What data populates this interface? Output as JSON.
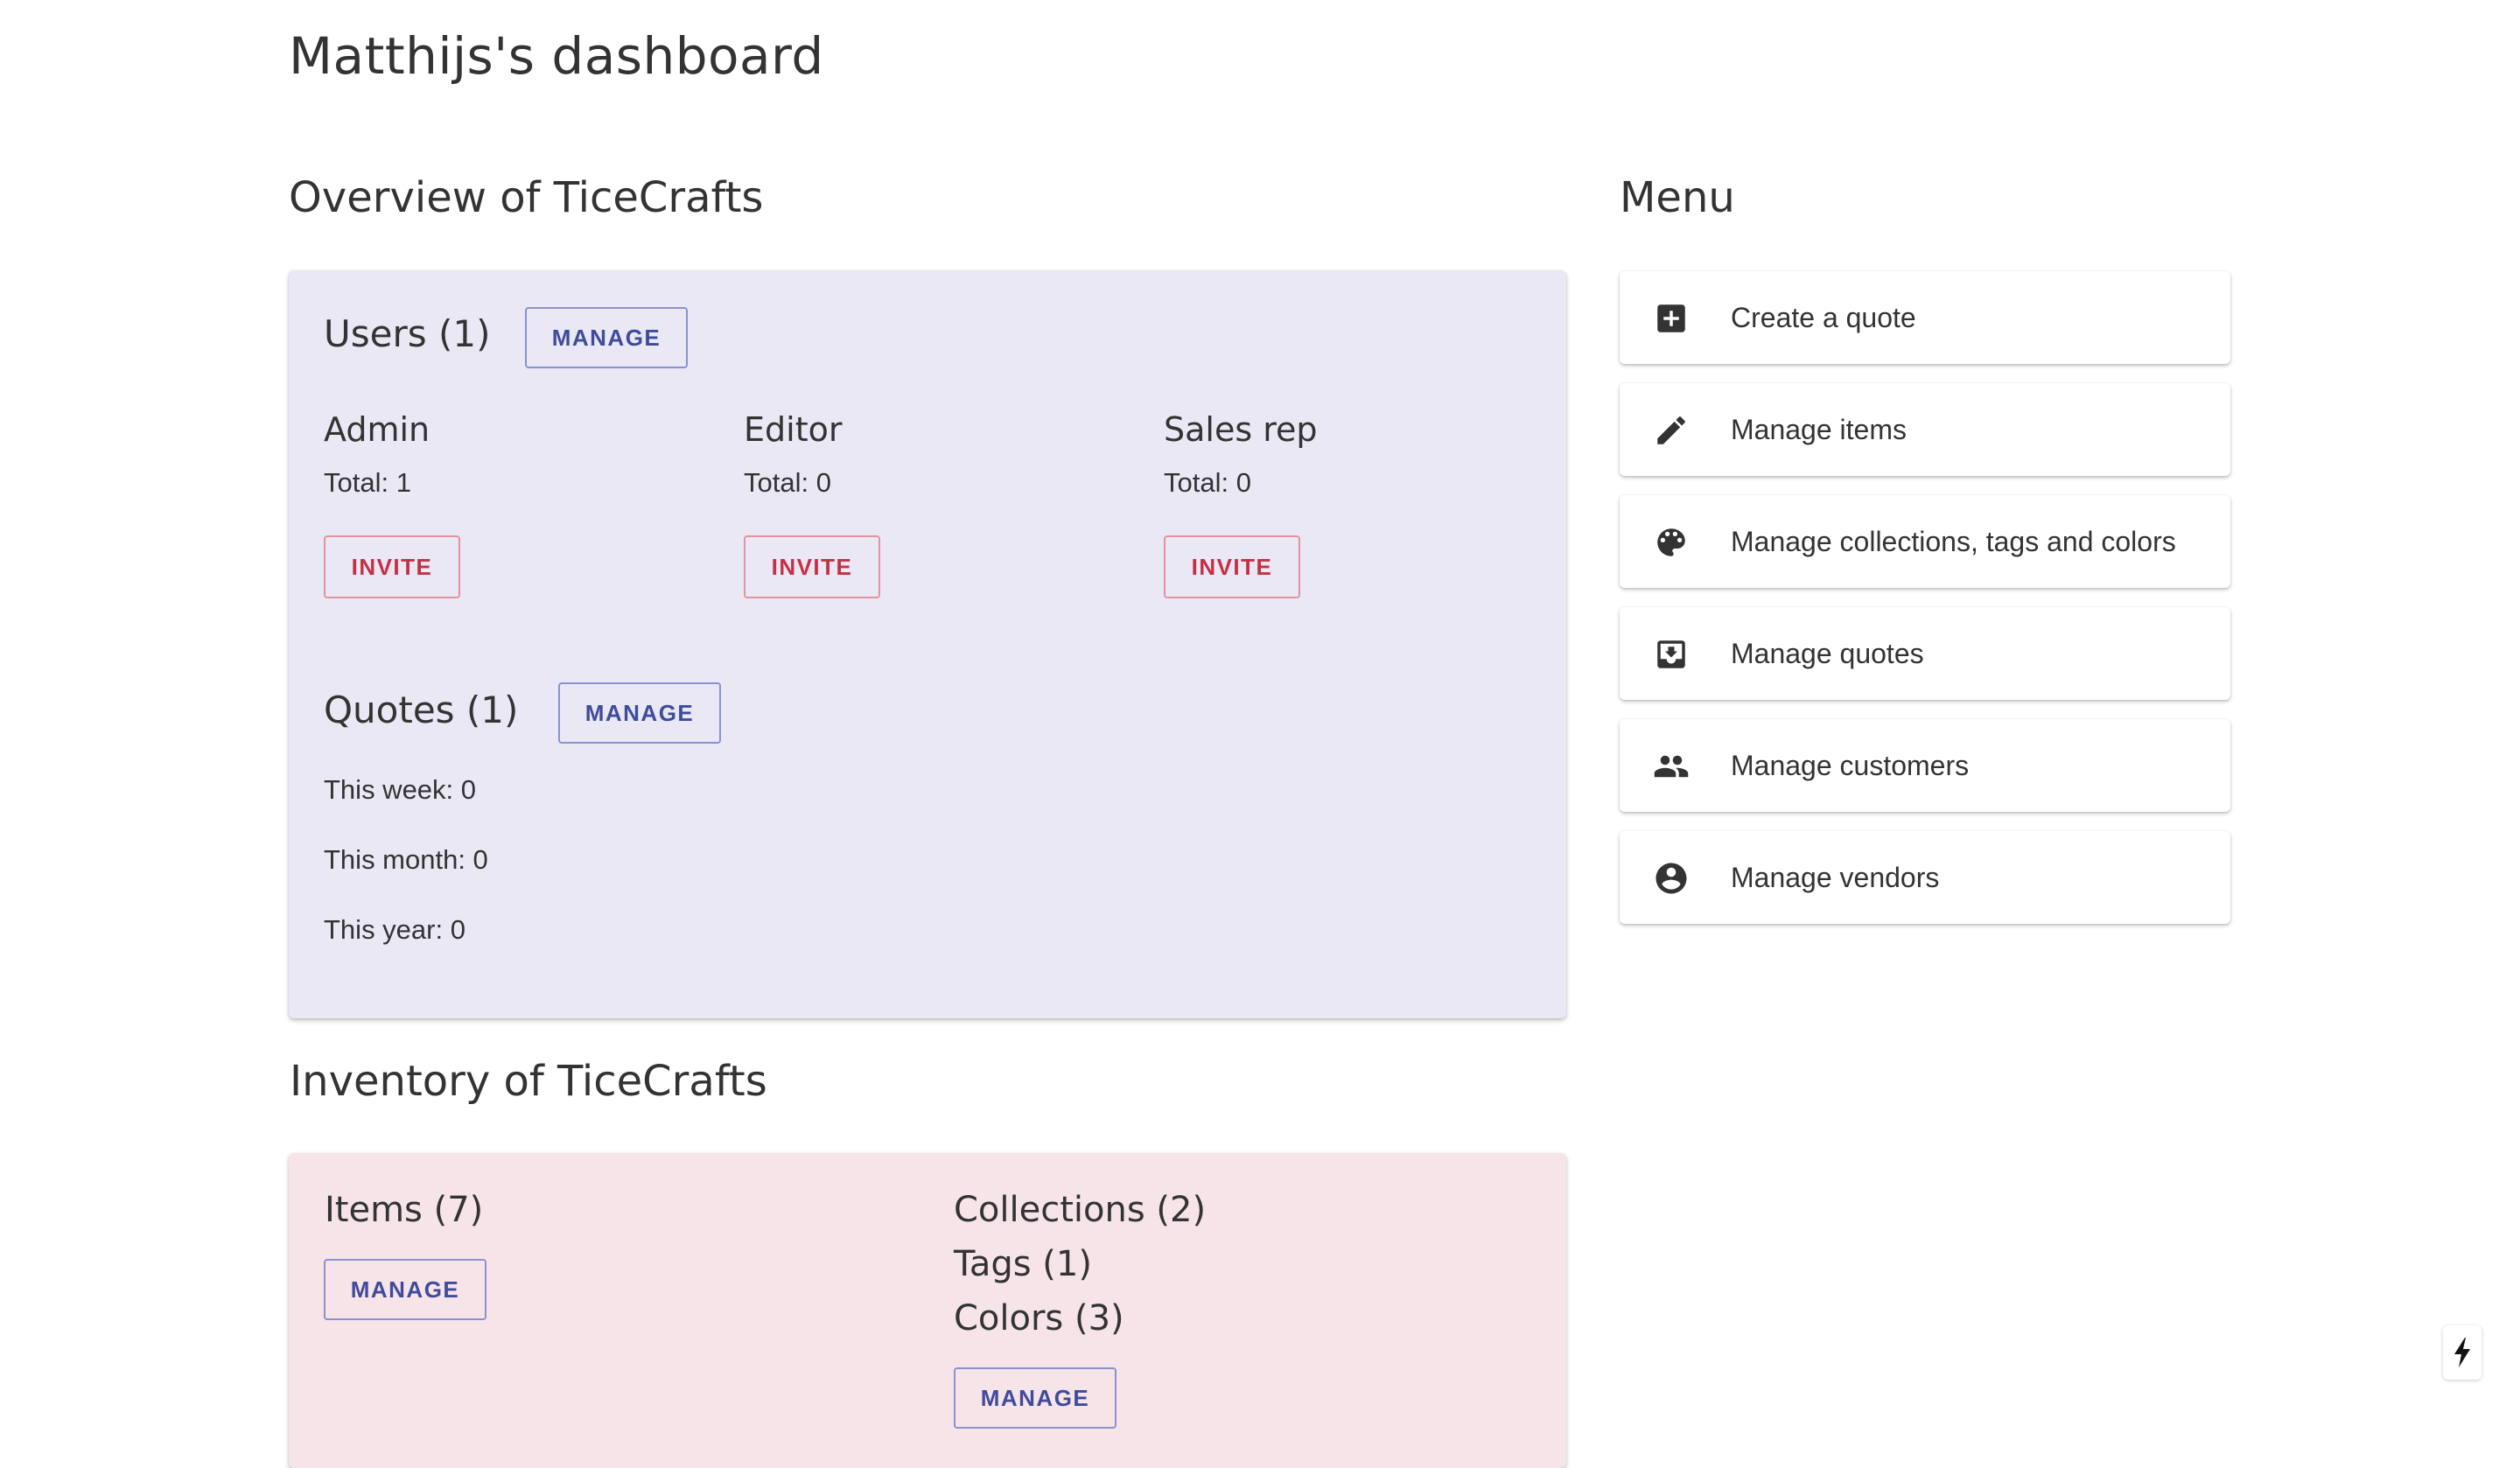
{
  "page": {
    "title": "Matthijs's dashboard"
  },
  "overview": {
    "title": "Overview of TiceCrafts",
    "users": {
      "title": "Users (1)",
      "manage_label": "MANAGE",
      "roles": [
        {
          "name": "Admin",
          "total": "Total: 1",
          "invite_label": "INVITE"
        },
        {
          "name": "Editor",
          "total": "Total: 0",
          "invite_label": "INVITE"
        },
        {
          "name": "Sales rep",
          "total": "Total: 0",
          "invite_label": "INVITE"
        }
      ]
    },
    "quotes": {
      "title": "Quotes (1)",
      "manage_label": "MANAGE",
      "stats": [
        "This week: 0",
        "This month: 0",
        "This year: 0"
      ]
    }
  },
  "inventory": {
    "title": "Inventory of TiceCrafts",
    "items": {
      "title": "Items (7)",
      "manage_label": "MANAGE"
    },
    "taxonomy": {
      "collections": "Collections (2)",
      "tags": "Tags (1)",
      "colors": "Colors (3)",
      "manage_label": "MANAGE"
    }
  },
  "menu": {
    "title": "Menu",
    "items": [
      {
        "label": "Create a quote",
        "icon": "add-box-icon"
      },
      {
        "label": "Manage items",
        "icon": "pencil-icon"
      },
      {
        "label": "Manage collections, tags and colors",
        "icon": "palette-icon"
      },
      {
        "label": "Manage quotes",
        "icon": "inbox-tray-icon"
      },
      {
        "label": "Manage customers",
        "icon": "people-icon"
      },
      {
        "label": "Manage vendors",
        "icon": "account-circle-icon"
      }
    ]
  },
  "colors": {
    "overview_bg": "#e9e8f4",
    "inventory_bg": "#f6e4e9",
    "manage_accent": "#3f4b9c",
    "invite_accent": "#c62f43",
    "text": "#333333"
  },
  "widgets": {
    "fab_icon": "lightning-bolt-icon"
  }
}
